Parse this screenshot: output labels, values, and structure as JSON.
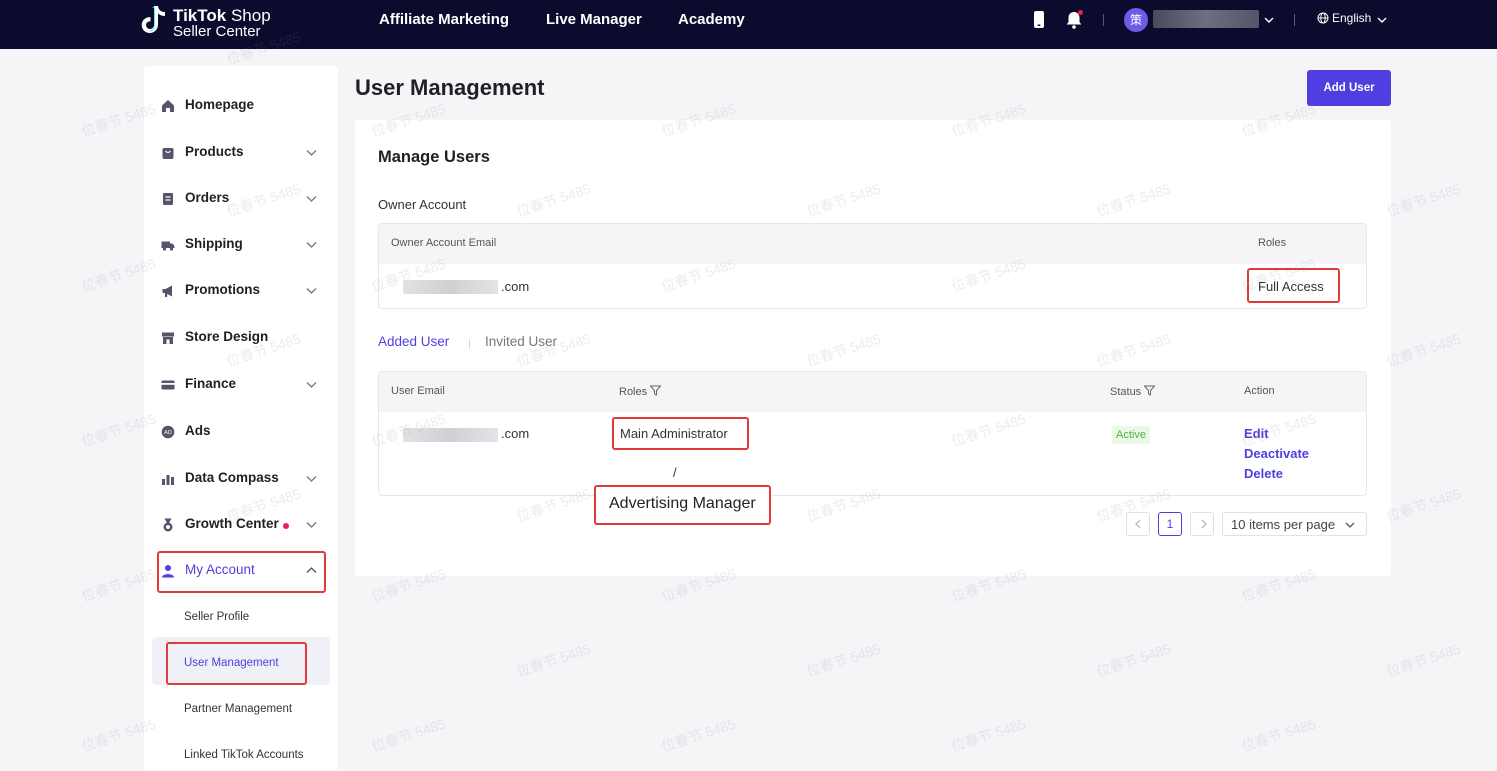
{
  "header": {
    "logo_line1_bold": "TikTok",
    "logo_line1_rest": " Shop",
    "logo_line2": "Seller Center",
    "nav": [
      "Affiliate Marketing",
      "Live Manager",
      "Academy"
    ],
    "avatar_glyph": "策",
    "language": "English"
  },
  "sidebar": {
    "items": [
      {
        "label": "Homepage",
        "icon": "home-icon"
      },
      {
        "label": "Products",
        "icon": "bag-icon"
      },
      {
        "label": "Orders",
        "icon": "clipboard-icon"
      },
      {
        "label": "Shipping",
        "icon": "truck-icon"
      },
      {
        "label": "Promotions",
        "icon": "megaphone-icon"
      },
      {
        "label": "Store Design",
        "icon": "store-icon"
      },
      {
        "label": "Finance",
        "icon": "card-icon"
      },
      {
        "label": "Ads",
        "icon": "ads-icon"
      },
      {
        "label": "Data Compass",
        "icon": "chart-icon"
      },
      {
        "label": "Growth Center",
        "icon": "medal-icon"
      },
      {
        "label": "My Account",
        "icon": "person-icon"
      }
    ],
    "sub_items": [
      "Seller Profile",
      "User Management",
      "Partner Management",
      "Linked TikTok Accounts"
    ]
  },
  "main": {
    "page_title": "User Management",
    "add_user_label": "Add User",
    "card_title": "Manage Users",
    "owner_section_label": "Owner Account",
    "owner_table": {
      "headers": [
        "Owner Account Email",
        "Roles"
      ],
      "email_suffix": ".com",
      "role": "Full Access"
    },
    "tabs": [
      "Added User",
      "Invited User"
    ],
    "users_table": {
      "headers": [
        "User Email",
        "Roles",
        "Status",
        "Action"
      ],
      "row": {
        "email_suffix": ".com",
        "role": "Main Administrator",
        "role_separator": "/",
        "status": "Active",
        "actions": [
          "Edit",
          "Deactivate",
          "Delete"
        ]
      }
    },
    "pagination": {
      "current_page": "1",
      "per_page": "10 items per page"
    },
    "callout_role": "Advertising Manager"
  },
  "watermark_text": "位春节 5485",
  "colors": {
    "accent": "#4f3fe0",
    "topbar": "#0b0b2e",
    "highlight": "#e03a3a",
    "status_active": "#4fb43e"
  }
}
